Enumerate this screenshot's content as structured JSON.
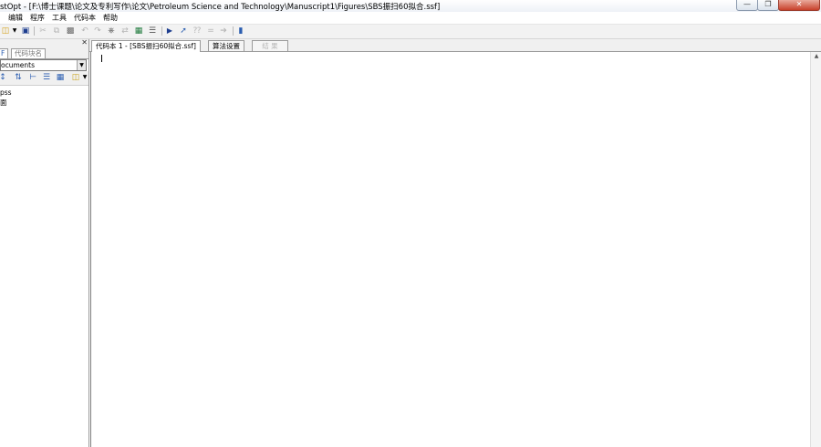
{
  "window": {
    "title": "stOpt - [F:\\博士课题\\论文及专利写作\\论文\\Petroleum Science and Technology\\Manuscript1\\Figures\\SBS振扫60拟合.ssf]",
    "controls": [
      "—",
      "❐",
      "✕"
    ]
  },
  "menu": [
    "编辑",
    "程序",
    "工具",
    "代码本",
    "帮助"
  ],
  "toolbar": {
    "icons": [
      "open-icon",
      "dropdown-icon",
      "save-icon",
      "cut-icon",
      "copy-icon",
      "paste-icon",
      "undo-icon",
      "redo-icon",
      "find-icon",
      "replace-icon",
      "excel-icon",
      "format-icon",
      "run-icon",
      "step-icon",
      "pause-icon",
      "stop-icon",
      "output-icon",
      "help-book-icon"
    ]
  },
  "left_panel": {
    "tabs": [
      "F",
      "代码块名"
    ],
    "combo_value": "ocuments",
    "tree_items": [
      "pss",
      "面"
    ]
  },
  "doc_tabs": [
    "代码本 1 - [SBS振扫60拟合.ssf]",
    "算法设置",
    "结 果"
  ],
  "colors": {
    "accent": "#2a5db0",
    "border": "#9a9a9a"
  }
}
